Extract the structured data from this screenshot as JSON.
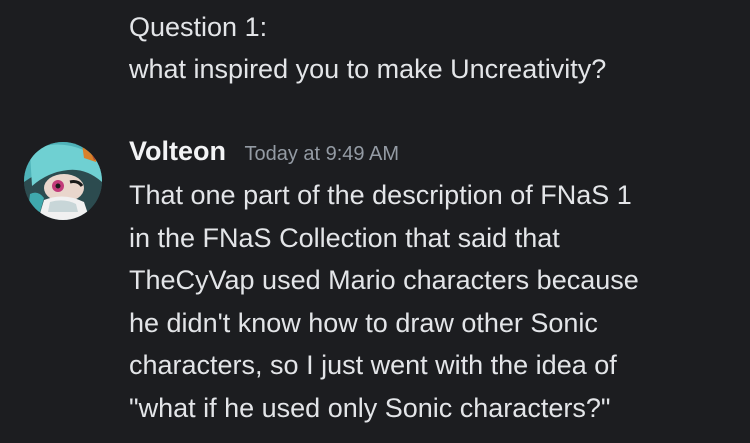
{
  "previous_message": {
    "lines": [
      "Question 1:",
      "what inspired you to make Uncreativity?"
    ]
  },
  "message": {
    "author": "Volteon",
    "timestamp": "Today at 9:49 AM",
    "lines": [
      "That one part of the description of FNaS 1",
      "in the FNaS Collection that said that",
      "TheCyVap used Mario characters because",
      "he didn't know how to draw other Sonic",
      "characters, so I just went with the idea of",
      "\"what if he used only Sonic characters?\""
    ]
  },
  "colors": {
    "background": "#1c1d20",
    "text": "#e3e5e8",
    "username": "#f2f3f5",
    "timestamp": "#949ba4"
  }
}
